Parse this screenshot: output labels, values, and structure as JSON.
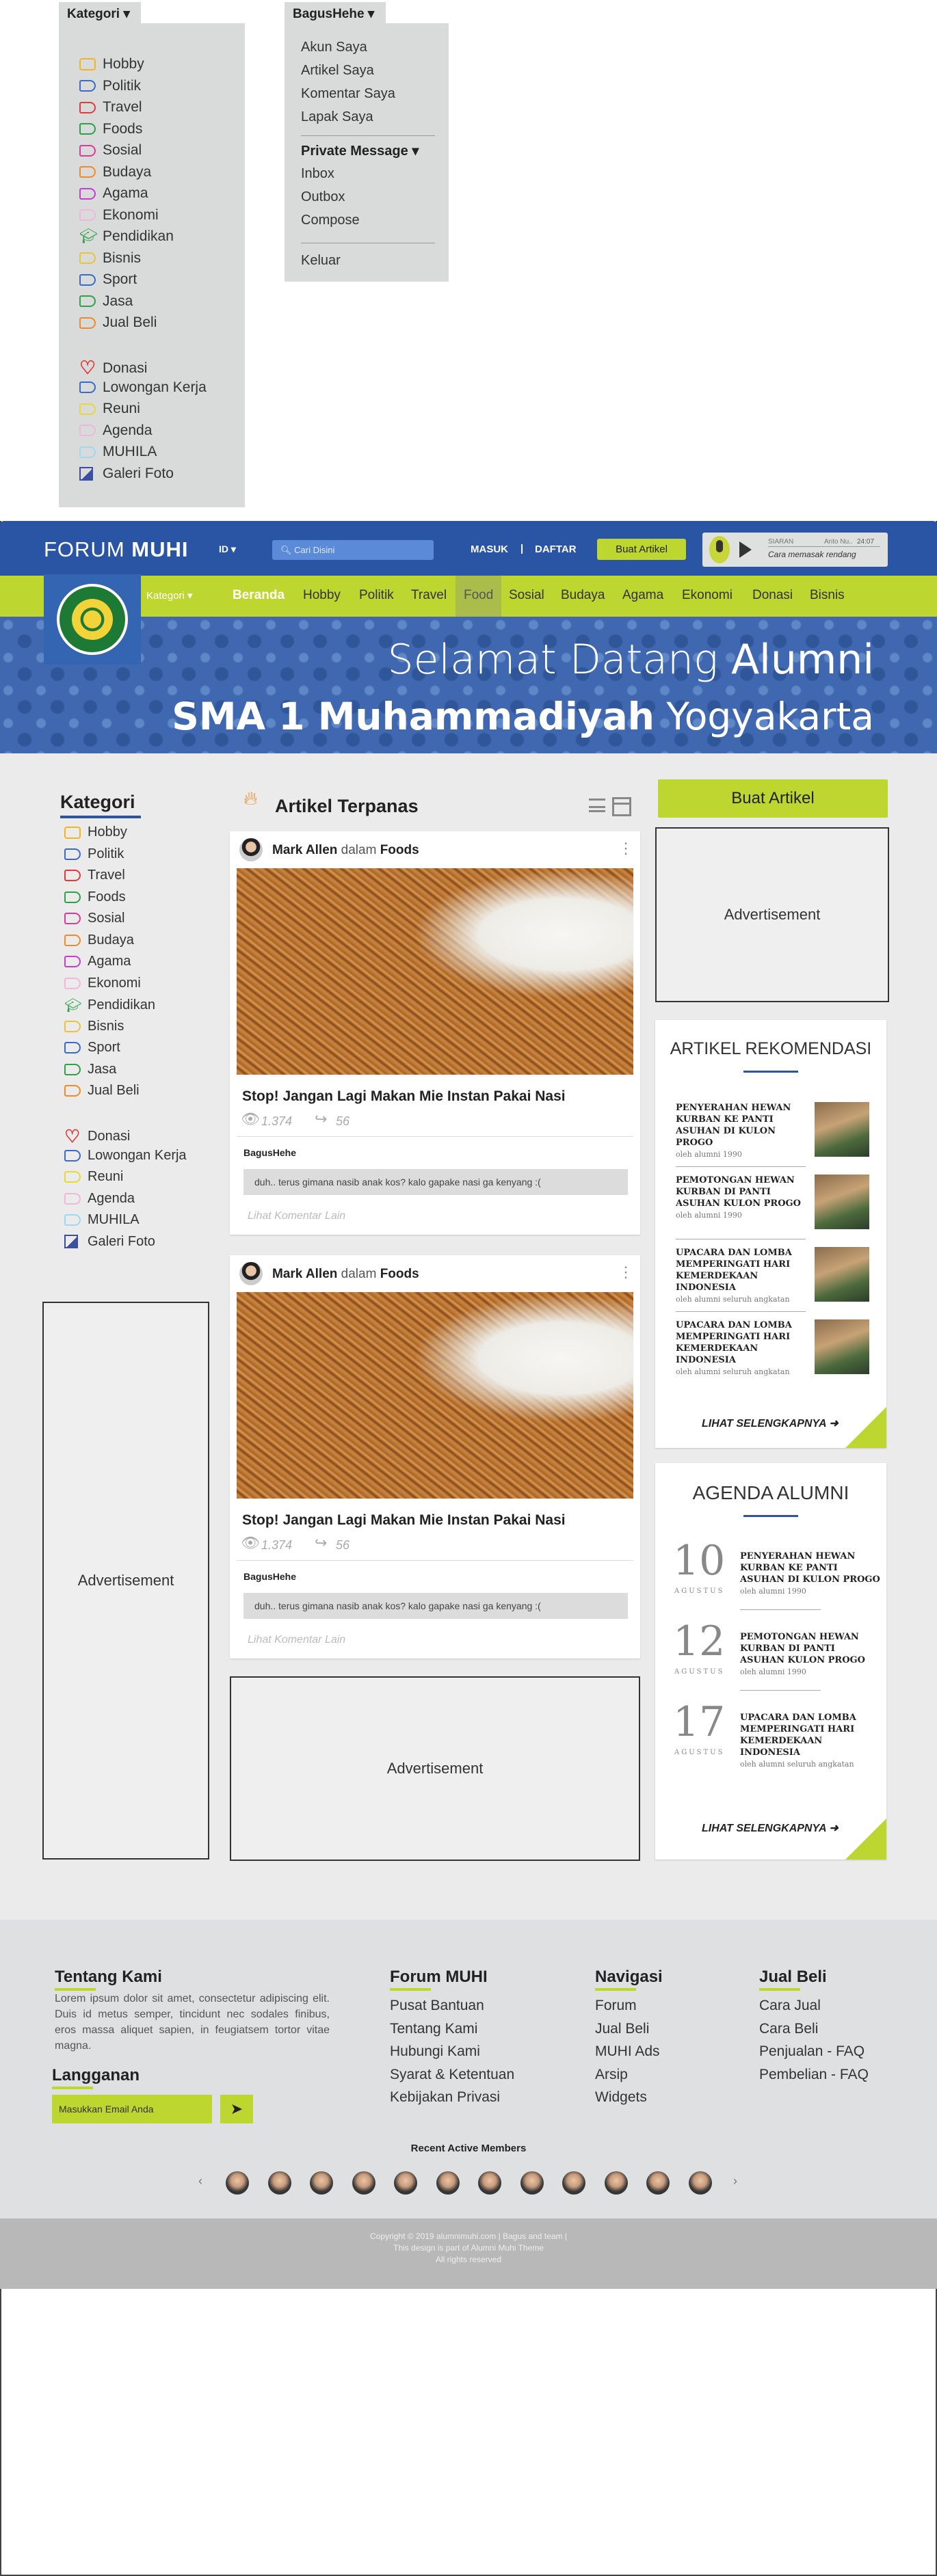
{
  "kategori_menu": {
    "tab": "Kategori ▾",
    "items": [
      {
        "label": "Hobby",
        "color": "#f2b424",
        "icon": "camera-icon"
      },
      {
        "label": "Politik",
        "color": "#3a6bc9",
        "icon": "tag-icon"
      },
      {
        "label": "Travel",
        "color": "#e03b3b",
        "icon": "tag-icon"
      },
      {
        "label": "Foods",
        "color": "#2fa04a",
        "icon": "tag-icon"
      },
      {
        "label": "Sosial",
        "color": "#e0389a",
        "icon": "tag-icon"
      },
      {
        "label": "Budaya",
        "color": "#f08b2a",
        "icon": "tag-icon"
      },
      {
        "label": "Agama",
        "color": "#c23fd0",
        "icon": "tag-icon"
      },
      {
        "label": "Ekonomi",
        "color": "#f0b8d8",
        "icon": "tag-icon"
      },
      {
        "label": "Pendidikan",
        "color": "#2fa04a",
        "icon": "graduation-cap-icon"
      },
      {
        "label": "Bisnis",
        "color": "#e8c43a",
        "icon": "tag-icon"
      },
      {
        "label": "Sport",
        "color": "#3a6bc9",
        "icon": "tag-icon"
      },
      {
        "label": "Jasa",
        "color": "#2fa04a",
        "icon": "tag-icon"
      },
      {
        "label": "Jual Beli",
        "color": "#f08b2a",
        "icon": "tag-icon"
      }
    ],
    "extra": [
      {
        "label": "Donasi",
        "color": "#e03b3b",
        "icon": "heart-icon"
      },
      {
        "label": "Lowongan Kerja",
        "color": "#3a6bc9",
        "icon": "tag-icon"
      },
      {
        "label": "Reuni",
        "color": "#e8d83a",
        "icon": "tag-icon"
      },
      {
        "label": "Agenda",
        "color": "#f0b8d8",
        "icon": "tag-icon"
      },
      {
        "label": "MUHILA",
        "color": "#9fd8f0",
        "icon": "tag-icon"
      },
      {
        "label": "Galeri Foto",
        "color": "#3a4fa0",
        "icon": "photo-icon"
      }
    ]
  },
  "user_menu": {
    "tab": "BagusHehe ▾",
    "items": [
      "Akun Saya",
      "Artikel Saya",
      "Komentar Saya",
      "Lapak Saya"
    ],
    "pm_label": "Private Message ▾",
    "pm_items": [
      "Inbox",
      "Outbox",
      "Compose"
    ],
    "logout": "Keluar"
  },
  "header": {
    "brand_a": "FORUM ",
    "brand_b": "MUHI",
    "lang": "ID ▾",
    "search_placeholder": "Cari Disini",
    "masuk": "MASUK",
    "sep": "|",
    "daftar": "DAFTAR",
    "buat": "Buat Artikel",
    "player": {
      "name": "SIARAN",
      "artist": "Anto Nu..",
      "time": "24:07",
      "title": "Cara memasak rendang"
    }
  },
  "nav": {
    "kategori": "Kategori ▾",
    "beranda": "Beranda",
    "items": [
      "Hobby",
      "Politik",
      "Travel",
      "Food",
      "Sosial",
      "Budaya",
      "Agama",
      "Ekonomi",
      "Donasi",
      "Bisnis"
    ]
  },
  "hero": {
    "l1a": "Selamat Datang ",
    "l1b": "Alumni",
    "l2a": "SMA 1 Muhammadiyah",
    "l2b": " Yogyakarta"
  },
  "sidebar": {
    "title": "Kategori",
    "ad": "Advertisement"
  },
  "feed": {
    "title": "Artikel Terpanas",
    "posts": [
      {
        "author": "Mark Allen",
        "dalam": "dalam",
        "cat": "Foods",
        "title": "Stop! Jangan Lagi Makan Mie Instan Pakai Nasi",
        "views": "1.374",
        "shares": "56",
        "commenter": "BagusHehe",
        "comment": "duh.. terus gimana nasib anak kos? kalo gapake nasi ga kenyang :(",
        "more": "Lihat Komentar Lain"
      },
      {
        "author": "Mark Allen",
        "dalam": "dalam",
        "cat": "Foods",
        "title": "Stop! Jangan Lagi Makan Mie Instan Pakai Nasi",
        "views": "1.374",
        "shares": "56",
        "commenter": "BagusHehe",
        "comment": "duh.. terus gimana nasib anak kos? kalo gapake nasi ga kenyang :(",
        "more": "Lihat Komentar Lain"
      }
    ],
    "ad": "Advertisement"
  },
  "right": {
    "buat": "Buat Artikel",
    "ad": "Advertisement",
    "rek_title": "ARTIKEL REKOMENDASI",
    "rek": [
      {
        "t": "PENYERAHAN HEWAN KURBAN KE PANTI ASUHAN DI KULON PROGO",
        "s": "oleh alumni 1990"
      },
      {
        "t": "PEMOTONGAN HEWAN KURBAN DI PANTI ASUHAN KULON PROGO",
        "s": "oleh alumni 1990"
      },
      {
        "t": "UPACARA DAN LOMBA MEMPERINGATI HARI KEMERDEKAAN INDONESIA",
        "s": "oleh alumni seluruh angkatan"
      },
      {
        "t": "UPACARA DAN LOMBA MEMPERINGATI HARI KEMERDEKAAN INDONESIA",
        "s": "oleh alumni seluruh angkatan"
      }
    ],
    "more": "LIHAT SELENGKAPNYA",
    "ag_title": "AGENDA ALUMNI",
    "agenda": [
      {
        "d": "10",
        "m": "AGUSTUS",
        "t": "PENYERAHAN HEWAN KURBAN KE PANTI ASUHAN DI KULON PROGO",
        "s": "oleh alumni 1990"
      },
      {
        "d": "12",
        "m": "AGUSTUS",
        "t": "PEMOTONGAN HEWAN KURBAN DI PANTI ASUHAN KULON PROGO",
        "s": "oleh alumni 1990"
      },
      {
        "d": "17",
        "m": "AGUSTUS",
        "t": "UPACARA DAN LOMBA MEMPERINGATI HARI KEMERDEKAAN INDONESIA",
        "s": "oleh alumni seluruh angkatan"
      }
    ]
  },
  "footer": {
    "tentang": "Tentang Kami",
    "lorem": "Lorem ipsum dolor sit amet, consectetur adipiscing elit. Duis id metus semper, tincidunt nec sodales finibus, eros massa aliquet sapien, in feugiatsem tortor vitae magna.",
    "langganan": "Langganan",
    "email_ph": "Masukkan Email Anda",
    "cols": [
      {
        "h": "Forum MUHI",
        "l": [
          "Pusat Bantuan",
          "Tentang Kami",
          "Hubungi Kami",
          "Syarat & Ketentuan",
          "Kebijakan Privasi"
        ]
      },
      {
        "h": "Navigasi",
        "l": [
          "Forum",
          "Jual Beli",
          "MUHI Ads",
          "Arsip",
          "Widgets"
        ]
      },
      {
        "h": "Jual Beli",
        "l": [
          "Cara Jual",
          "Cara Beli",
          "Penjualan - FAQ",
          "Pembelian - FAQ"
        ]
      }
    ],
    "recent": "Recent Active Members",
    "prev": "‹",
    "next": "›",
    "copy1": "Copyright © 2019 alumnimuhi.com | Bagus and team |",
    "copy2": "This design is part of Alumni Muhi Theme",
    "copy3": "All rights reserved"
  }
}
